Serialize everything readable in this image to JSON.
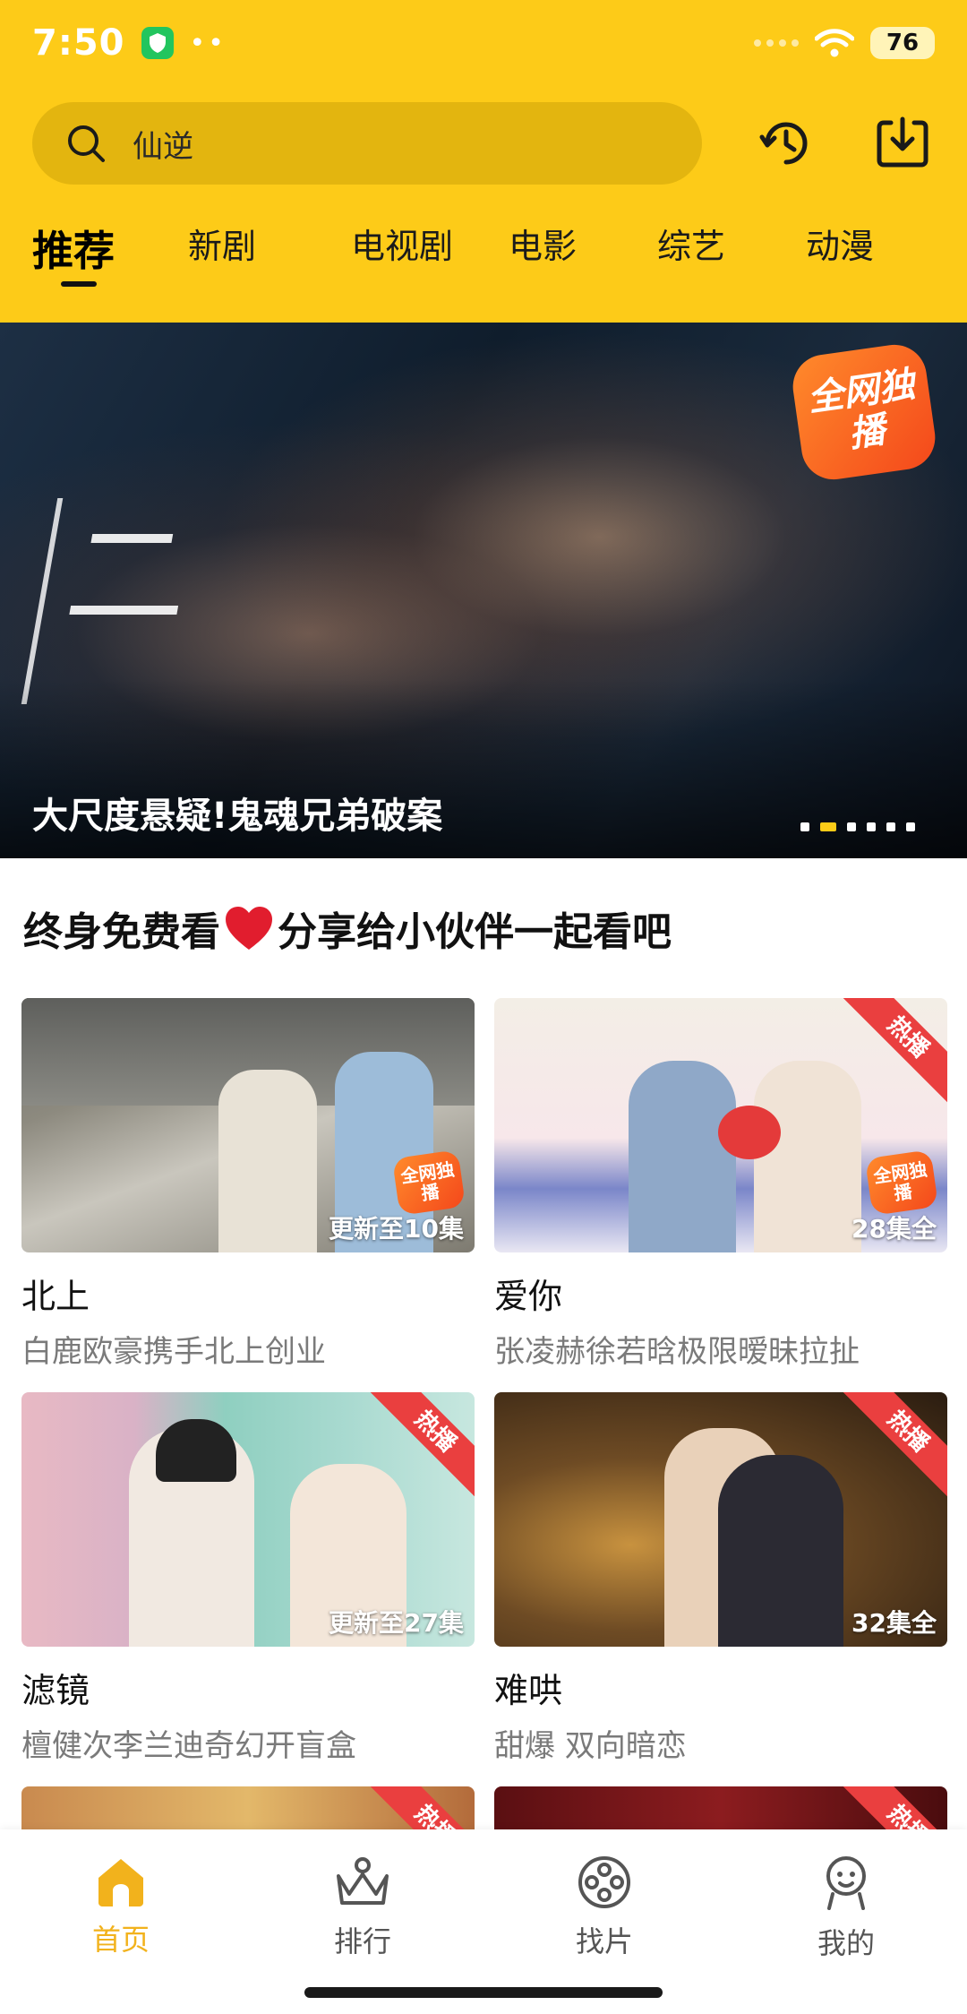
{
  "status_bar": {
    "time": "7:50",
    "battery": "76"
  },
  "search": {
    "query": "仙逆"
  },
  "tabs": [
    {
      "label": "推荐",
      "active": true
    },
    {
      "label": "新剧"
    },
    {
      "label": "电视剧"
    },
    {
      "label": "电影"
    },
    {
      "label": "综艺"
    },
    {
      "label": "动漫"
    }
  ],
  "banner": {
    "title": "大尺度悬疑!鬼魂兄弟破案",
    "badge": "全网独播",
    "slides_total": 6,
    "active_slide": 2
  },
  "section": {
    "title_pre": "终身免费看",
    "title_post": "分享给小伙伴一起看吧"
  },
  "cards": [
    {
      "title": "北上",
      "subtitle": "白鹿欧豪携手北上创业",
      "episodes": "更新至10集",
      "hot": "",
      "exclusive": "全网独播"
    },
    {
      "title": "爱你",
      "subtitle": "张凌赫徐若晗极限暧昧拉扯",
      "episodes": "28集全",
      "hot": "热播",
      "exclusive": "全网独播"
    },
    {
      "title": "滤镜",
      "subtitle": "檀健次李兰迪奇幻开盲盒",
      "episodes": "更新至27集",
      "hot": "热播",
      "exclusive": ""
    },
    {
      "title": "难哄",
      "subtitle": "甜爆 双向暗恋",
      "episodes": "32集全",
      "hot": "热播",
      "exclusive": ""
    },
    {
      "title": "",
      "subtitle": "",
      "episodes": "",
      "hot": "热播",
      "exclusive": ""
    },
    {
      "title": "",
      "subtitle": "",
      "episodes": "",
      "hot": "热播",
      "exclusive": ""
    }
  ],
  "bottom_nav": [
    {
      "label": "首页",
      "icon": "home-icon",
      "active": true
    },
    {
      "label": "排行",
      "icon": "crown-icon"
    },
    {
      "label": "找片",
      "icon": "film-reel-icon"
    },
    {
      "label": "我的",
      "icon": "profile-icon"
    }
  ],
  "colors": {
    "accent": "#FDCB18",
    "active_nav": "#F2B21C",
    "hot_badge": "#EA3F3F"
  }
}
